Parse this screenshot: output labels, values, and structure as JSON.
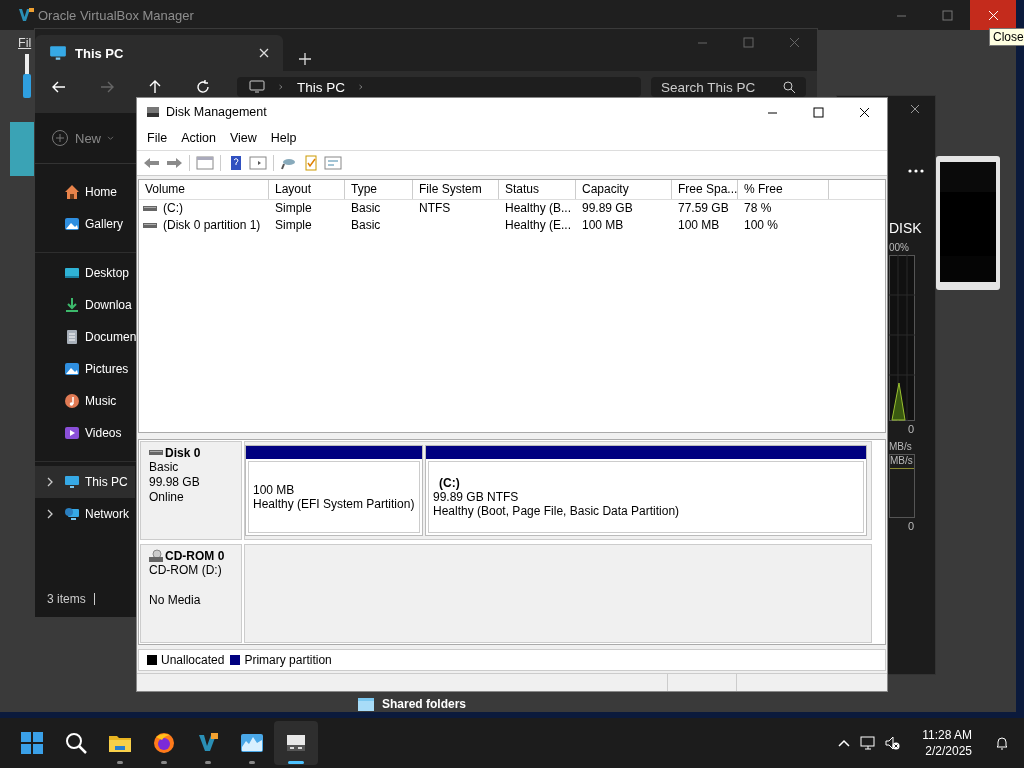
{
  "vbox": {
    "title": "Oracle VirtualBox Manager",
    "close_hovered": true,
    "tooltip": "Close",
    "menu": [
      "Fil"
    ],
    "details_label": "Shared folders"
  },
  "explorer": {
    "tab": "This PC",
    "breadcrumb": [
      "This PC"
    ],
    "search": {
      "placeholder": "Search This PC"
    },
    "new_button": "New",
    "sidebar_sections": [
      [
        {
          "label": "Home",
          "kind": "home",
          "selected": false,
          "expandable": false
        },
        {
          "label": "Gallery",
          "kind": "gallery",
          "selected": false,
          "expandable": false
        }
      ],
      [
        {
          "label": "Desktop",
          "kind": "desktop",
          "selected": false,
          "expandable": false
        },
        {
          "label": "Downloa",
          "kind": "downloads",
          "selected": false,
          "expandable": false
        },
        {
          "label": "Documen",
          "kind": "documents",
          "selected": false,
          "expandable": false
        },
        {
          "label": "Pictures",
          "kind": "pictures",
          "selected": false,
          "expandable": false
        },
        {
          "label": "Music",
          "kind": "music",
          "selected": false,
          "expandable": false
        },
        {
          "label": "Videos",
          "kind": "videos",
          "selected": false,
          "expandable": false
        }
      ],
      [
        {
          "label": "This PC",
          "kind": "pc",
          "selected": true,
          "expandable": true
        },
        {
          "label": "Network",
          "kind": "network",
          "selected": false,
          "expandable": true
        }
      ]
    ],
    "status": "3 items"
  },
  "monitor": {
    "title": "DISK",
    "scale": "00%",
    "readings": [
      "0",
      "MB/s",
      "MB/s",
      "0"
    ]
  },
  "disk_management": {
    "title": "Disk Management",
    "menu": [
      "File",
      "Action",
      "View",
      "Help"
    ],
    "columns": [
      "Volume",
      "Layout",
      "Type",
      "File System",
      "Status",
      "Capacity",
      "Free Spa...",
      "% Free"
    ],
    "rows": [
      {
        "volume": "(C:)",
        "layout": "Simple",
        "type": "Basic",
        "file_system": "NTFS",
        "status": "Healthy (B...",
        "capacity": "99.89 GB",
        "free_space": "77.59 GB",
        "percent_free": "78 %"
      },
      {
        "volume": "(Disk 0 partition 1)",
        "layout": "Simple",
        "type": "Basic",
        "status": "Healthy (E...",
        "capacity": "100 MB",
        "free_space": "100 MB",
        "percent_free": "100 %"
      }
    ],
    "disks": [
      {
        "kind": "disk",
        "name": "Disk 0",
        "lines": [
          "Basic",
          "99.98 GB",
          "Online"
        ],
        "partitions": [
          {
            "size": "100 MB",
            "status": "Healthy (EFI System Partition)"
          },
          {
            "label": "(C:)",
            "size": "99.89 GB NTFS",
            "status": "Healthy (Boot, Page File, Basic Data Partition)"
          }
        ]
      },
      {
        "kind": "cdrom",
        "name": "CD-ROM 0",
        "drive": "CD-ROM (D:)",
        "media": "No Media"
      }
    ],
    "legend": [
      {
        "label": "Unallocated",
        "color": "#000000"
      },
      {
        "label": "Primary partition",
        "color": "#000080"
      }
    ]
  },
  "taskbar": {
    "apps": [
      {
        "kind": "start",
        "active": false
      },
      {
        "kind": "search",
        "active": false
      },
      {
        "kind": "explorer",
        "running": true,
        "active": false
      },
      {
        "kind": "firefox",
        "running": true,
        "active": false
      },
      {
        "kind": "vbox",
        "running": true,
        "active": false
      },
      {
        "kind": "monitor",
        "running": true,
        "active": false
      },
      {
        "kind": "diskmgmt",
        "running": true,
        "active": true
      }
    ],
    "time": "11:28 AM",
    "date": "2/2/2025"
  }
}
